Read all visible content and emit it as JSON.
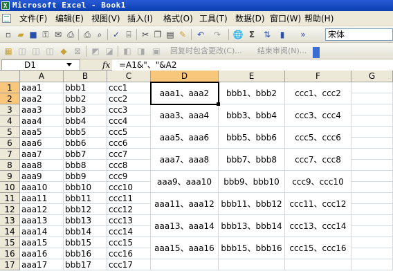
{
  "window": {
    "title": "Microsoft Excel - Book1",
    "app_icon": "excel-icon"
  },
  "menu": [
    "文件(F)",
    "编辑(E)",
    "视图(V)",
    "插入(I)",
    "格式(O)",
    "工具(T)",
    "数据(D)",
    "窗口(W)",
    "帮助(H)"
  ],
  "toolbar": {
    "font_name": "宋体",
    "autosum": "Σ"
  },
  "review_toolbar": {
    "reply_text": "回复时包含更改(C)...",
    "end_review": "结束审阅(N)..."
  },
  "formula_bar": {
    "name_box": "D1",
    "fx_label": "fx",
    "formula": "=A1&\"、\"&A2"
  },
  "columns": [
    "A",
    "B",
    "C",
    "D",
    "E",
    "F",
    "G"
  ],
  "active_column": "D",
  "rows": [
    "1",
    "2",
    "3",
    "4",
    "5",
    "6",
    "7",
    "8",
    "9",
    "10",
    "11",
    "12",
    "13",
    "14",
    "15",
    "16",
    "17"
  ],
  "col_a": [
    "aaa1",
    "aaa2",
    "aaa3",
    "aaa4",
    "aaa5",
    "aaa6",
    "aaa7",
    "aaa8",
    "aaa9",
    "aaa10",
    "aaa11",
    "aaa12",
    "aaa13",
    "aaa14",
    "aaa15",
    "aaa16",
    "aaa17"
  ],
  "col_b": [
    "bbb1",
    "bbb2",
    "bbb3",
    "bbb4",
    "bbb5",
    "bbb6",
    "bbb7",
    "bbb8",
    "bbb9",
    "bbb10",
    "bbb11",
    "bbb12",
    "bbb13",
    "bbb14",
    "bbb15",
    "bbb16",
    "bbb17"
  ],
  "col_c": [
    "ccc1",
    "ccc2",
    "ccc3",
    "ccc4",
    "ccc5",
    "ccc6",
    "ccc7",
    "ccc8",
    "ccc9",
    "ccc10",
    "ccc11",
    "ccc12",
    "ccc13",
    "ccc14",
    "ccc15",
    "ccc16",
    "ccc17"
  ],
  "merged_d": [
    "aaa1、aaa2",
    "aaa3、aaa4",
    "aaa5、aaa6",
    "aaa7、aaa8",
    "aaa9、aaa10",
    "aaa11、aaa12",
    "aaa13、aaa14",
    "aaa15、aaa16"
  ],
  "merged_e": [
    "bbb1、bbb2",
    "bbb3、bbb4",
    "bbb5、bbb6",
    "bbb7、bbb8",
    "bbb9、bbb10",
    "bbb11、bbb12",
    "bbb13、bbb14",
    "bbb15、bbb16"
  ],
  "merged_f": [
    "ccc1、ccc2",
    "ccc3、ccc4",
    "ccc5、ccc6",
    "ccc7、ccc8",
    "ccc9、ccc10",
    "ccc11、ccc12",
    "ccc13、ccc14",
    "ccc15、ccc16"
  ]
}
